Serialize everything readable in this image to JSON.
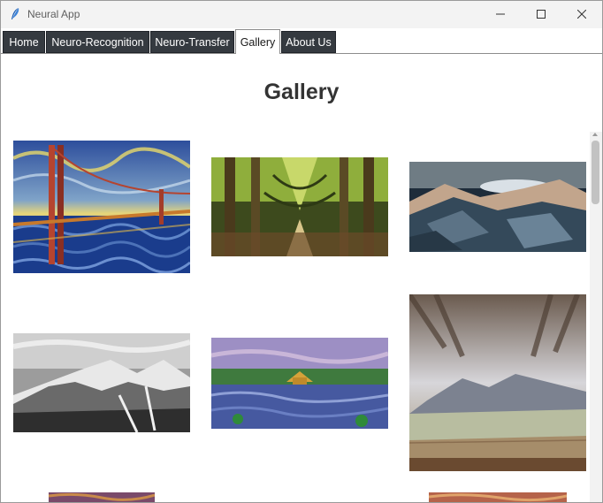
{
  "window": {
    "title": "Neural App"
  },
  "tabs": [
    {
      "label": "Home"
    },
    {
      "label": "Neuro-Recognition"
    },
    {
      "label": "Neuro-Transfer"
    },
    {
      "label": "Gallery"
    },
    {
      "label": "About Us"
    }
  ],
  "active_tab": "Gallery",
  "page": {
    "heading": "Gallery"
  },
  "gallery": {
    "images": [
      {
        "subject": "golden-gate-bridge-starry-style"
      },
      {
        "subject": "forest-path-painting"
      },
      {
        "subject": "mountain-lake-polygon"
      },
      {
        "subject": "snowy-mountains-grayscale"
      },
      {
        "subject": "lake-temple-impressionist"
      },
      {
        "subject": "mountain-valley-dreamy"
      },
      {
        "subject": "partial-thumbnail-left"
      },
      {
        "subject": "partial-thumbnail-right"
      }
    ]
  },
  "colors": {
    "tab_bg": "#353a40",
    "tab_text": "#ffffff",
    "heading": "#333333"
  }
}
